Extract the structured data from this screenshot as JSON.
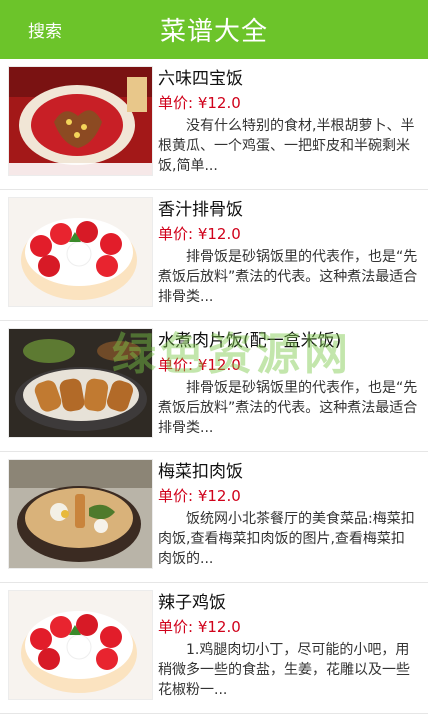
{
  "header": {
    "search_label": "搜索",
    "title": "菜谱大全"
  },
  "items": [
    {
      "name": "六味四宝饭",
      "price": "单价: ¥12.0",
      "desc": "没有什么特别的食材,半根胡萝卜、半根黄瓜、一个鸡蛋、一把虾皮和半碗剩米饭,简单..."
    },
    {
      "name": "香汁排骨饭",
      "price": "单价: ¥12.0",
      "desc": "排骨饭是砂锅饭里的代表作，也是“先煮饭后放料”煮法的代表。这种煮法最适合排骨类..."
    },
    {
      "name": "水煮肉片饭(配一盒米饭)",
      "price": "单价: ¥12.0",
      "desc": "排骨饭是砂锅饭里的代表作，也是“先煮饭后放料”煮法的代表。这种煮法最适合排骨类..."
    },
    {
      "name": "梅菜扣肉饭",
      "price": "单价: ¥12.0",
      "desc": "饭统网小北茶餐厅的美食菜品:梅菜扣肉饭,查看梅菜扣肉饭的图片,查看梅菜扣肉饭的..."
    },
    {
      "name": "辣子鸡饭",
      "price": "单价: ¥12.0",
      "desc": "1.鸡腿肉切小丁，尽可能的小吧，用稍微多一些的食盐，生姜，花雕以及一些花椒粉一..."
    }
  ],
  "watermark": "绿色资源网"
}
